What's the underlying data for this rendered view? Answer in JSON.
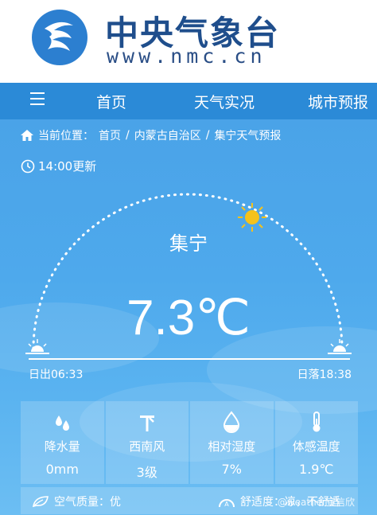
{
  "header": {
    "brand_name": "中央气象台",
    "brand_url": "www.nmc.cn"
  },
  "nav": {
    "menu_icon": "hamburger-menu-icon",
    "items": [
      {
        "label": "首页"
      },
      {
        "label": "天气实况"
      },
      {
        "label": "城市预报"
      }
    ]
  },
  "breadcrumb": {
    "prefix": "当前位置：",
    "items": [
      "首页",
      "内蒙古自治区",
      "集宁天气预报"
    ],
    "separator": "/"
  },
  "update": {
    "time_text": "14:00更新"
  },
  "weather": {
    "city": "集宁",
    "temperature": "7.3℃",
    "sunrise": "日出06:33",
    "sunset": "日落18:38",
    "sun_arc_progress": 0.72
  },
  "stats": [
    {
      "icon": "raindrops-icon",
      "label": "降水量",
      "value": "0mm"
    },
    {
      "icon": "wind-turbine-icon",
      "label": "西南风",
      "value": "3级"
    },
    {
      "icon": "humidity-drop-icon",
      "label": "相对湿度",
      "value": "7%"
    },
    {
      "icon": "thermometer-icon",
      "label": "体感温度",
      "value": "1.9℃"
    }
  ],
  "bottom": {
    "air_quality": "空气质量：优",
    "comfort": "舒适度：凉，不舒适",
    "watermark": "@weather宣信欣"
  },
  "colors": {
    "nav_bg": "#2b8ad7",
    "brand_text": "#1f4e8c",
    "sky_top": "#4aa3e8",
    "sun": "#f5c21b"
  }
}
